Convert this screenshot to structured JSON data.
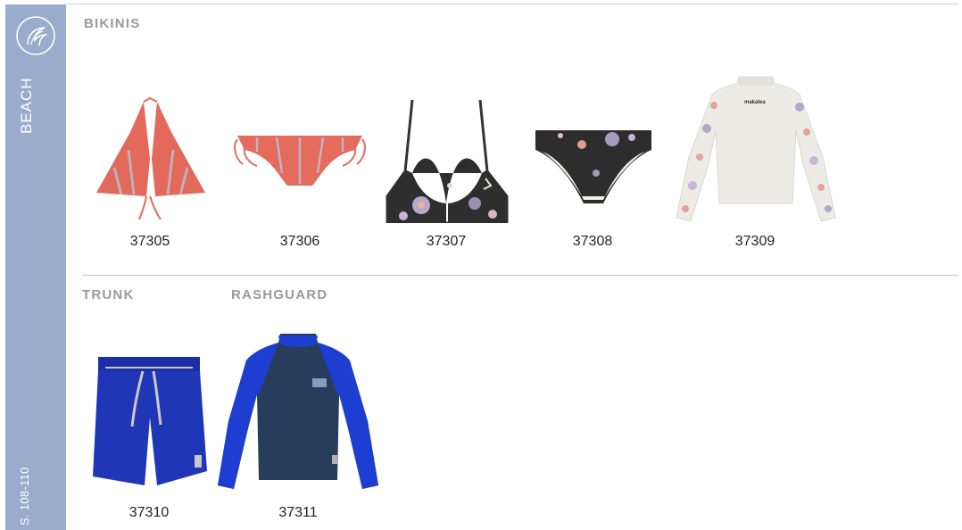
{
  "sidebar": {
    "section": "BEACH",
    "pages": "S. 108-110",
    "icon": "wave-logo-icon",
    "color": "#9aaccb"
  },
  "sections": {
    "bikinis": "BIKINIS",
    "trunk": "TRUNK",
    "rashguard": "RASHGUARD"
  },
  "products": [
    {
      "code": "37305"
    },
    {
      "code": "37306"
    },
    {
      "code": "37307"
    },
    {
      "code": "37308"
    },
    {
      "code": "37309"
    },
    {
      "code": "37310"
    },
    {
      "code": "37311"
    }
  ]
}
